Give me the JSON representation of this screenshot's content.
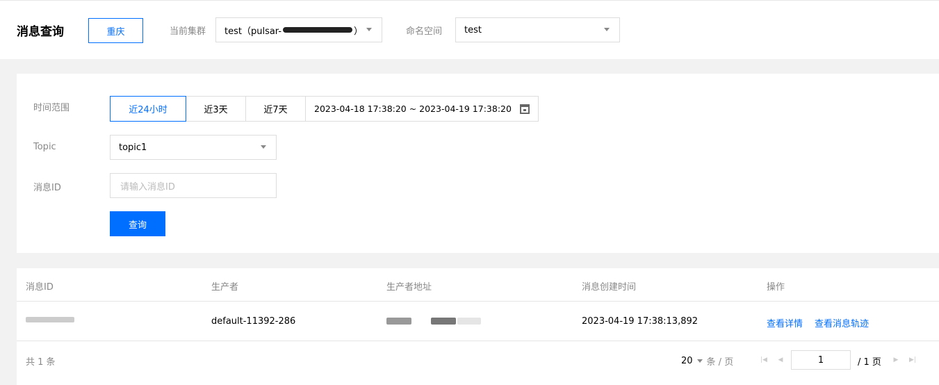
{
  "header": {
    "title": "消息查询",
    "region": "重庆",
    "cluster_label": "当前集群",
    "cluster_value_prefix": "test（pulsar-",
    "cluster_value_suffix": "）",
    "namespace_label": "命名空间",
    "namespace_value": "test"
  },
  "filter": {
    "time_label": "时间范围",
    "time_options": [
      "近24小时",
      "近3天",
      "近7天"
    ],
    "time_range": "2023-04-18 17:38:20 ~ 2023-04-19 17:38:20",
    "topic_label": "Topic",
    "topic_value": "topic1",
    "msgid_label": "消息ID",
    "msgid_placeholder": "请输入消息ID",
    "query_button": "查询"
  },
  "table": {
    "columns": [
      "消息ID",
      "生产者",
      "生产者地址",
      "消息创建时间",
      "操作"
    ],
    "rows": [
      {
        "producer": "default-11392-286",
        "created": "2023-04-19 17:38:13,892",
        "action_detail": "查看详情",
        "action_trace": "查看消息轨迹"
      }
    ]
  },
  "footer": {
    "total": "共 1 条",
    "page_size": "20",
    "per_page_label": "条 / 页",
    "current_page": "1",
    "total_pages": "/ 1 页"
  },
  "colors": {
    "accent": "#006eff",
    "label": "#888888",
    "border": "#dddddd"
  }
}
